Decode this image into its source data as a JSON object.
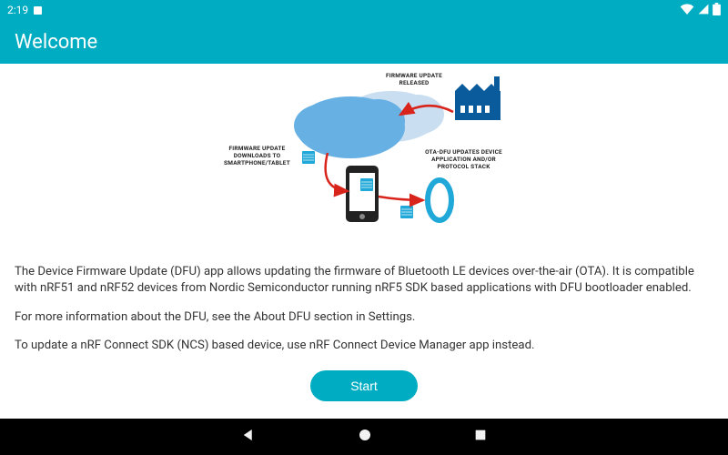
{
  "status_bar": {
    "time": "2:19"
  },
  "app_bar": {
    "title": "Welcome"
  },
  "diagram": {
    "label_top": "FIRMWARE UPDATE RELEASED",
    "label_left": "FIRMWARE UPDATE DOWNLOADS TO SMARTPHONE/TABLET",
    "label_right": "OTA-DFU UPDATES DEVICE APPLICATION AND/OR PROTOCOL STACK"
  },
  "body": {
    "p1": "The Device Firmware Update (DFU) app allows updating the firmware of Bluetooth LE devices over-the-air (OTA). It is compatible with nRF51 and nRF52 devices from Nordic Semiconductor running nRF5 SDK based applications with DFU bootloader enabled.",
    "p2": "For more information about the DFU, see the About DFU section in Settings.",
    "p3": "To update a nRF Connect SDK (NCS) based device, use nRF Connect Device Manager app instead."
  },
  "buttons": {
    "start": "Start"
  }
}
